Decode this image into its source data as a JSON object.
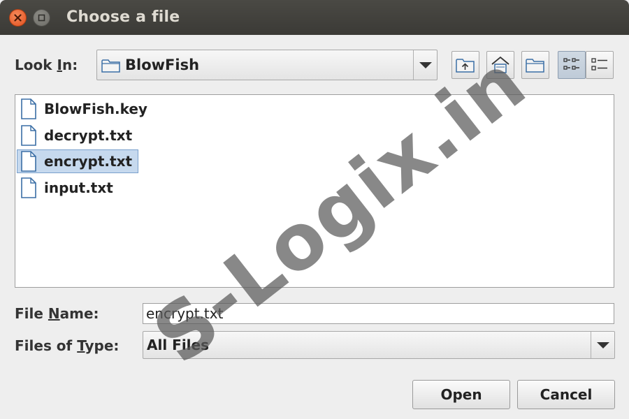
{
  "window": {
    "title": "Choose a file"
  },
  "look_in": {
    "label_before": "Look ",
    "label_mnemonic": "I",
    "label_after": "n:",
    "value": "BlowFish"
  },
  "toolbar": {
    "icons": [
      "up-one-level-icon",
      "home-icon",
      "new-folder-icon",
      "list-view-icon",
      "details-view-icon"
    ],
    "active_view": "list-view"
  },
  "files": [
    {
      "name": "BlowFish.key",
      "selected": false
    },
    {
      "name": "decrypt.txt",
      "selected": false
    },
    {
      "name": "encrypt.txt",
      "selected": true
    },
    {
      "name": "input.txt",
      "selected": false
    }
  ],
  "file_name": {
    "label_before": "File ",
    "label_mnemonic": "N",
    "label_after": "ame:",
    "value": "encrypt.txt"
  },
  "files_of_type": {
    "label_before": "Files of ",
    "label_mnemonic": "T",
    "label_after": "ype:",
    "value": "All Files"
  },
  "buttons": {
    "open": "Open",
    "cancel": "Cancel"
  },
  "watermark": "S-Logix.in",
  "colors": {
    "titlebar": "#3b3a36",
    "close_button": "#e2501f",
    "selection": "#c6d9ee",
    "icon_blue": "#3a6ea5"
  }
}
